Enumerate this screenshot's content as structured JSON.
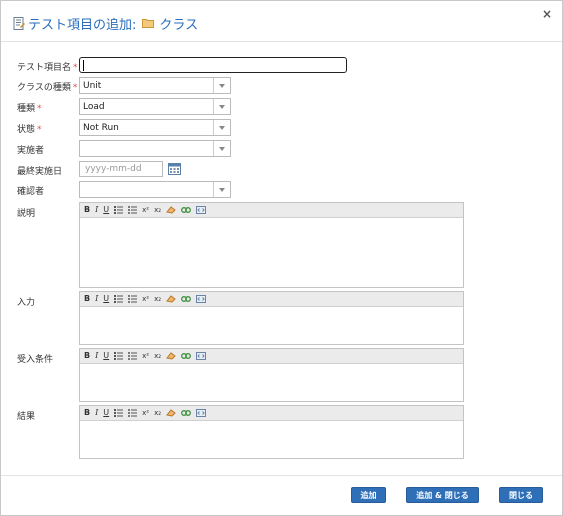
{
  "dialog": {
    "title": "テスト項目の追加:",
    "subject": "クラス",
    "close_label": "×"
  },
  "form": {
    "name_label": "テスト項目名",
    "name_value": "",
    "class_type_label": "クラスの種類",
    "class_type_value": "Unit",
    "kind_label": "種類",
    "kind_value": "Load",
    "status_label": "状態",
    "status_value": "Not Run",
    "executor_label": "実施者",
    "executor_value": "",
    "last_exec_label": "最終実施日",
    "last_exec_placeholder": "yyyy-mm-dd",
    "reviewer_label": "確認者",
    "reviewer_value": "",
    "required_mark": "*"
  },
  "editors": {
    "description_label": "説明",
    "input_label": "入力",
    "acceptance_label": "受入条件",
    "result_label": "結果",
    "toolbar": {
      "bold": "B",
      "italic": "I",
      "underline": "U",
      "superscript": "x²",
      "subscript": "x₂"
    }
  },
  "footer": {
    "add_label": "追加",
    "add_close_label": "追加 & 閉じる",
    "close_label": "閉じる"
  },
  "colors": {
    "title": "#2a6ebb",
    "primary_button": "#2f6fb8",
    "required": "#d9534f"
  }
}
